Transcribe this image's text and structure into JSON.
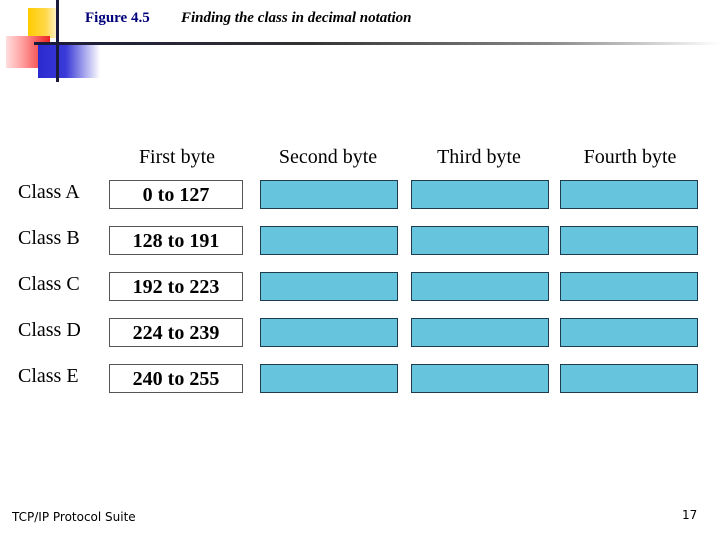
{
  "figure": {
    "label": "Figure 4.5",
    "title": "Finding the class in decimal notation"
  },
  "columns": [
    "First byte",
    "Second byte",
    "Third byte",
    "Fourth byte"
  ],
  "rows": [
    {
      "class": "Class A",
      "range": "0 to 127"
    },
    {
      "class": "Class B",
      "range": "128 to 191"
    },
    {
      "class": "Class C",
      "range": "192 to 223"
    },
    {
      "class": "Class D",
      "range": "224 to 239"
    },
    {
      "class": "Class E",
      "range": "240 to 255"
    }
  ],
  "colors": {
    "byte_fill": "#66c4dd",
    "byte_border": "#1d3d4f",
    "figure_label": "#00007a"
  },
  "footer": {
    "left": "TCP/IP Protocol Suite",
    "page_number": "17"
  }
}
